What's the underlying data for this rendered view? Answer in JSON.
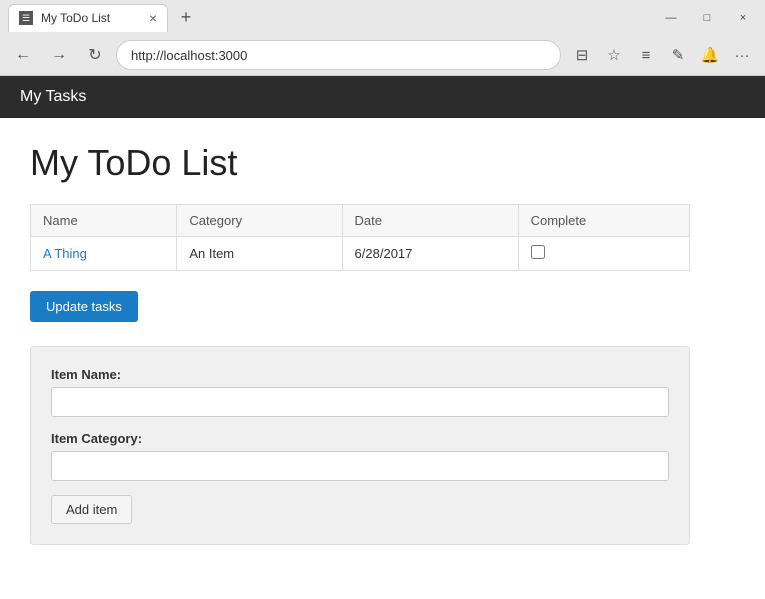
{
  "browser": {
    "tab": {
      "favicon": "☰",
      "title": "My ToDo List",
      "close_icon": "×"
    },
    "new_tab_icon": "+",
    "window_controls": {
      "minimize": "—",
      "maximize": "□",
      "close": "×"
    },
    "nav": {
      "back_icon": "←",
      "forward_icon": "→",
      "refresh_icon": "↻"
    },
    "url": "http://localhost:3000",
    "toolbar": {
      "reader_icon": "⊟",
      "favorites_icon": "☆",
      "hub_icon": "≡",
      "web_notes_icon": "✎",
      "share_icon": "🔔",
      "more_icon": "···"
    }
  },
  "app": {
    "header_title": "My Tasks",
    "page_title": "My ToDo List",
    "table": {
      "columns": [
        "Name",
        "Category",
        "Date",
        "Complete"
      ],
      "rows": [
        {
          "name": "A Thing",
          "category": "An Item",
          "date": "6/28/2017",
          "complete": false
        }
      ]
    },
    "update_button_label": "Update tasks",
    "form": {
      "item_name_label": "Item Name:",
      "item_name_placeholder": "",
      "item_category_label": "Item Category:",
      "item_category_placeholder": "",
      "add_button_label": "Add item"
    }
  }
}
